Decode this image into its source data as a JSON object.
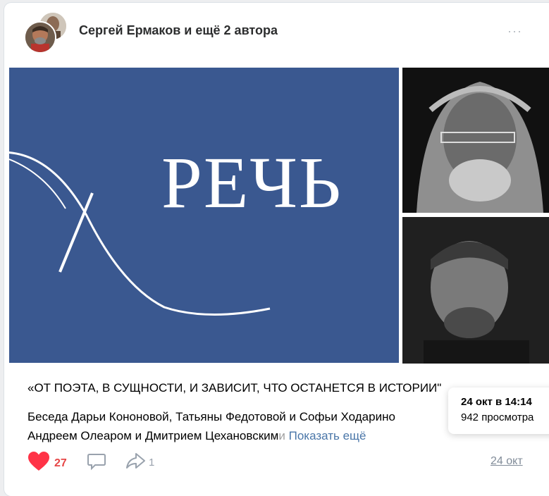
{
  "post": {
    "author": "Сергей Ермаков и ещё 2 автора",
    "more_icon": "···",
    "poster_logo": "РЕЧЬ",
    "quote": "«ОТ ПОЭТА, В СУЩНОСТИ, И ЗАВИСИТ, ЧТО ОСТАНЕТСЯ В ИСТОРИИ\"",
    "desc_line1": "Беседа Дарьи Кононовой, Татьяны Федотовой и Софьи Ходарино",
    "desc_line2": "Андреем Олеаром и Дмитрием Цехановским",
    "desc_fade": "и",
    "show_more": "Показать ещё",
    "likes": "27",
    "shares": "1",
    "date": "24 окт"
  },
  "tooltip": {
    "datetime": "24 окт в 14:14",
    "views": "942 просмотра"
  },
  "colors": {
    "poster_bg": "#3a5890",
    "like": "#e64646",
    "link": "#4a76a8"
  }
}
